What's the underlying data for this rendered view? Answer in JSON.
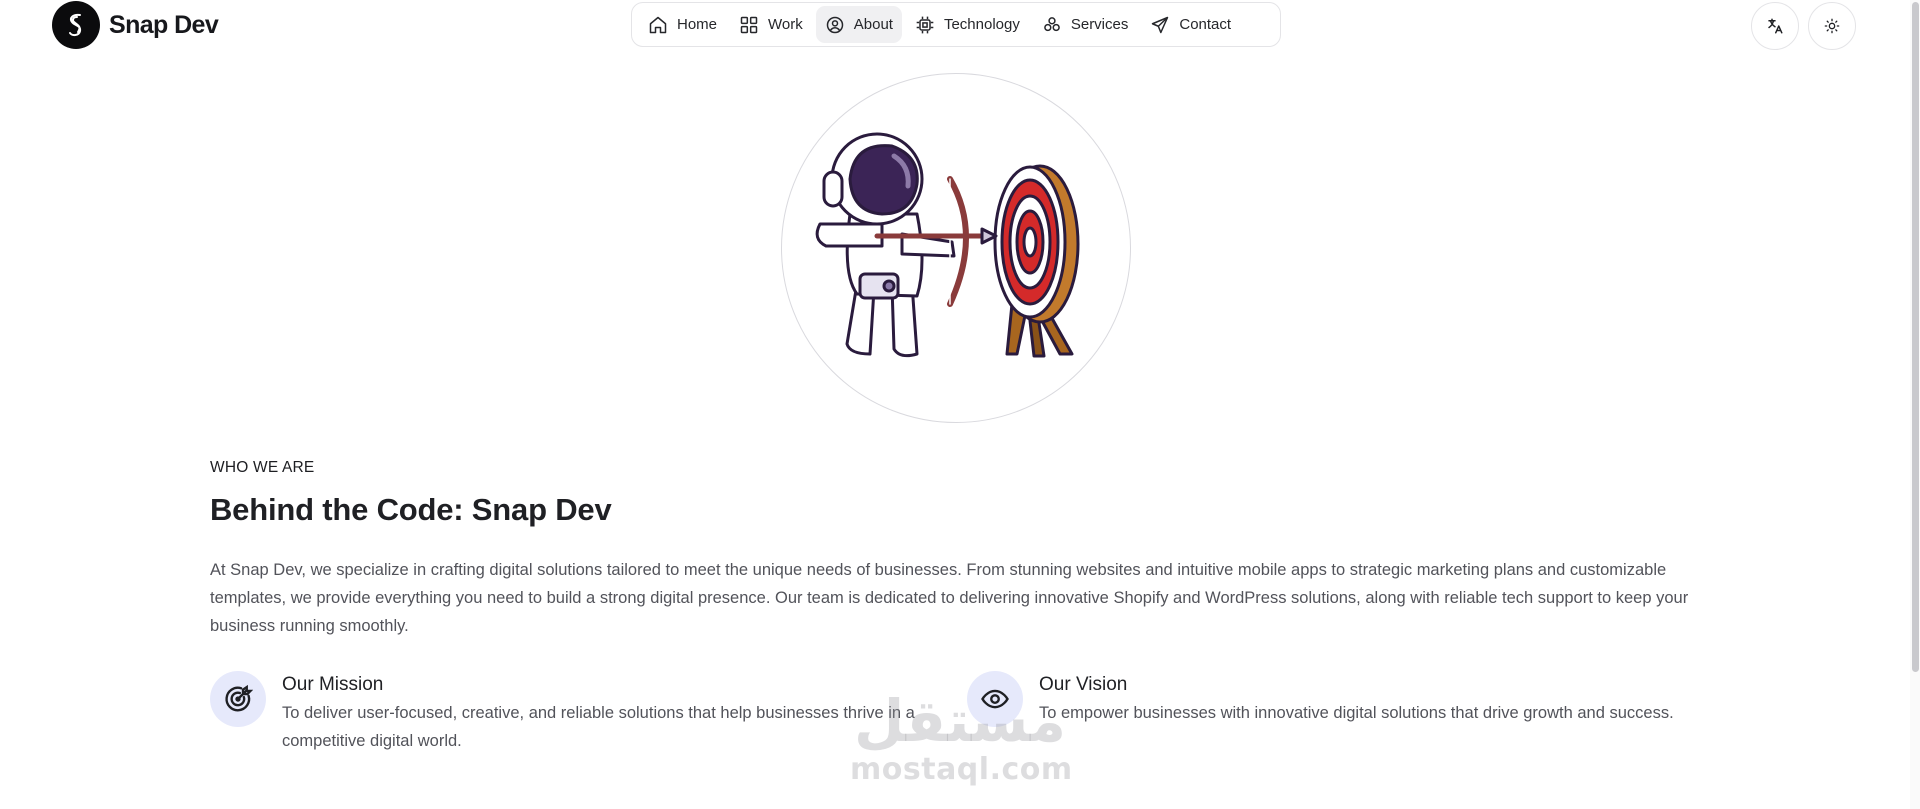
{
  "brand": {
    "name": "Snap Dev",
    "logo_icon": "s-swirl-logo"
  },
  "nav": {
    "items": [
      {
        "label": "Home",
        "icon": "home-icon"
      },
      {
        "label": "Work",
        "icon": "grid-icon"
      },
      {
        "label": "About",
        "icon": "user-circle-icon",
        "active": true
      },
      {
        "label": "Technology",
        "icon": "cpu-icon"
      },
      {
        "label": "Services",
        "icon": "components-icon"
      },
      {
        "label": "Contact",
        "icon": "send-icon"
      }
    ]
  },
  "header_actions": {
    "translate_icon": "translate-icon",
    "theme_icon": "sun-icon"
  },
  "hero": {
    "illustration": "astronaut-archer-target"
  },
  "about": {
    "eyebrow": "WHO WE ARE",
    "title": "Behind the Code: Snap Dev",
    "description": "At Snap Dev, we specialize in crafting digital solutions tailored to meet the unique needs of businesses. From stunning websites and intuitive mobile apps to strategic marketing plans and customizable templates, we provide everything you need to build a strong digital presence. Our team is dedicated to delivering innovative Shopify and WordPress solutions, along with reliable tech support to keep your business running smoothly."
  },
  "mission": {
    "title": "Our Mission",
    "text": "To deliver user-focused, creative, and reliable solutions that help businesses thrive in a competitive digital world.",
    "icon": "target-icon"
  },
  "vision": {
    "title": "Our Vision",
    "text": "To empower businesses with innovative digital solutions that drive growth and success.",
    "icon": "eye-icon"
  },
  "watermark": {
    "arabic": "مستقل",
    "latin": "mostaql.com"
  },
  "colors": {
    "accent_bg": "#e6e9fb",
    "text_dark": "#1f2024",
    "text_muted": "#52535a",
    "border": "#e4e4e7"
  }
}
